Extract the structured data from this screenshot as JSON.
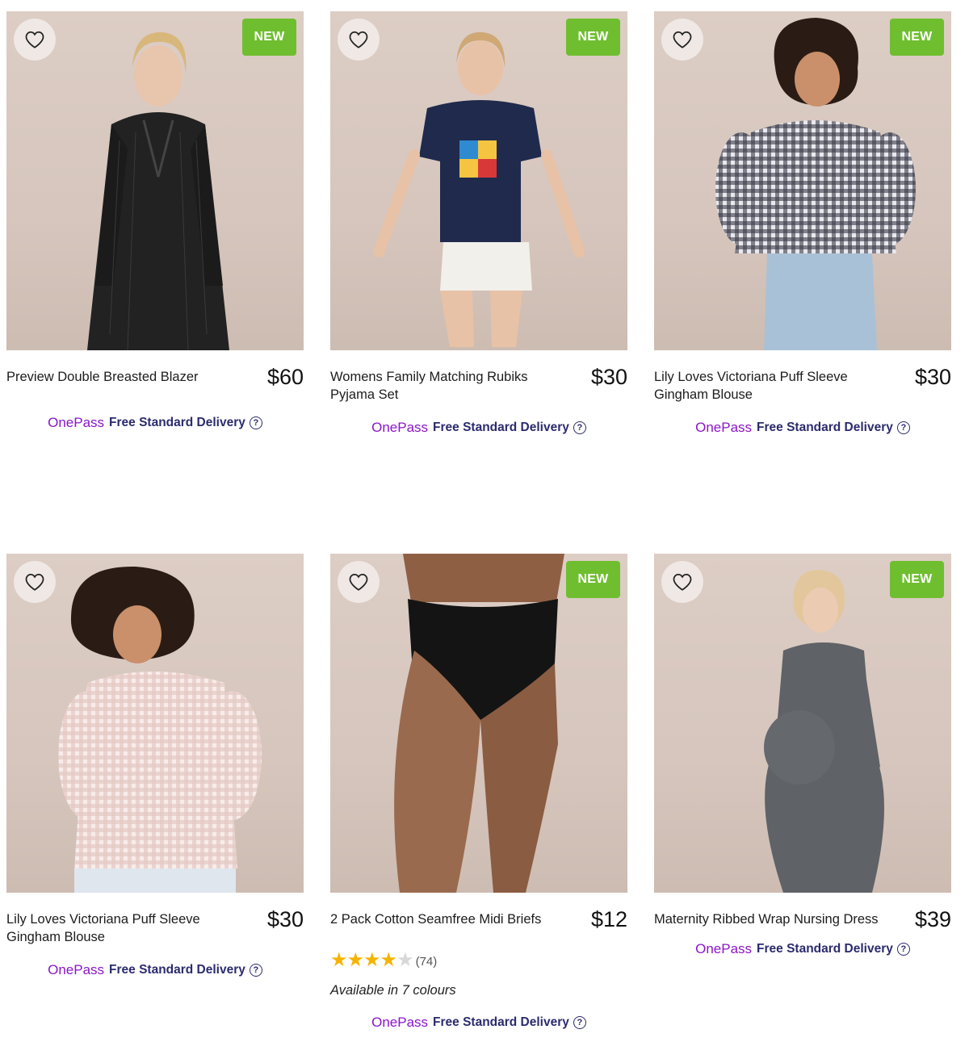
{
  "common": {
    "badge_new": "NEW",
    "onepass_brand": "OnePass",
    "delivery_text": "Free Standard Delivery",
    "help_glyph": "?"
  },
  "products": [
    {
      "name": "Preview Double Breasted Blazer",
      "price": "$60",
      "new": true,
      "garment_color": "#1e1e1e",
      "pants_color": "#232323"
    },
    {
      "name": "Womens Family Matching Rubiks Pyjama Set",
      "price": "$30",
      "new": true,
      "garment_color": "#1f2a4d",
      "pants_color": "#f1f0ea"
    },
    {
      "name": "Lily Loves Victoriana Puff Sleeve Gingham Blouse",
      "price": "$30",
      "new": true,
      "garment_color": "#6d6d78",
      "pants_color": "#a9c1d6"
    },
    {
      "name": "Lily Loves Victoriana Puff Sleeve Gingham Blouse",
      "price": "$30",
      "new": false,
      "garment_color": "#f1e2df",
      "pants_color": "#dfe6ee"
    },
    {
      "name": "2 Pack Cotton Seamfree Midi Briefs",
      "price": "$12",
      "new": true,
      "garment_color": "#141414",
      "pants_color": "#9a6a4e",
      "rating": {
        "stars": 4,
        "count": "(74)"
      },
      "availability": "Available in 7 colours"
    },
    {
      "name": "Maternity Ribbed Wrap Nursing Dress",
      "price": "$39",
      "new": true,
      "garment_color": "#5f6266",
      "pants_color": "#5f6266"
    }
  ]
}
